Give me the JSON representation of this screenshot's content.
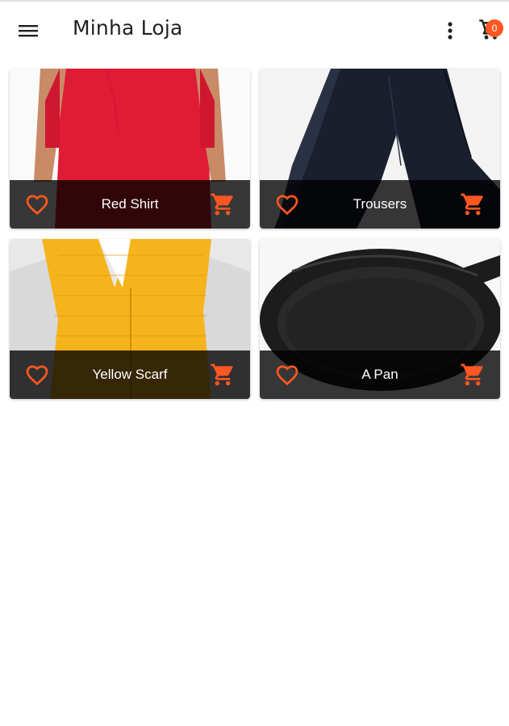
{
  "appbar": {
    "title": "Minha Loja",
    "menu_icon": "menu-icon",
    "more_icon": "more-vert-icon",
    "cart_icon": "shopping-cart-icon",
    "cart_count": "0"
  },
  "colors": {
    "accent": "#ff5722",
    "bar_overlay": "rgba(0,0,0,0.78)",
    "title_text": "#212121"
  },
  "products": [
    {
      "name": "Red Shirt",
      "fav_icon": "heart-outline-icon",
      "cart_icon": "add-shopping-cart-icon",
      "image": "red-shirt-photo"
    },
    {
      "name": "Trousers",
      "fav_icon": "heart-outline-icon",
      "cart_icon": "add-shopping-cart-icon",
      "image": "trousers-photo"
    },
    {
      "name": "Yellow Scarf",
      "fav_icon": "heart-outline-icon",
      "cart_icon": "add-shopping-cart-icon",
      "image": "yellow-scarf-photo"
    },
    {
      "name": "A Pan",
      "fav_icon": "heart-outline-icon",
      "cart_icon": "add-shopping-cart-icon",
      "image": "frying-pan-photo"
    }
  ]
}
